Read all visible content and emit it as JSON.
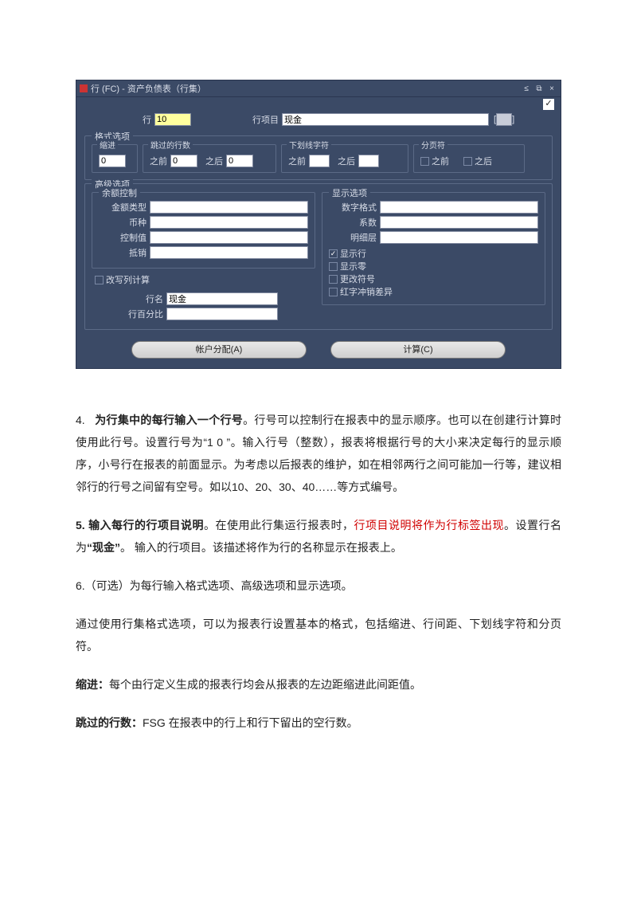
{
  "window": {
    "title": "行 (FC) - 资产负债表（行集）",
    "top_checked": "✓",
    "row_label": "行",
    "row_value": "10",
    "item_label": "行项目",
    "item_value": "现金",
    "bracket_left": "[",
    "bracket_right": "]"
  },
  "format": {
    "group": "格式选项",
    "indent_group": "缩进",
    "indent_value": "0",
    "skip_group": "跳过的行数",
    "before_label": "之前",
    "before_value": "0",
    "after_label": "之后",
    "after_value": "0",
    "underline_group": "下划线字符",
    "pagebreak_group": "分页符",
    "pb_before": "之前",
    "pb_after": "之后"
  },
  "adv": {
    "group": "高级选项",
    "balance_group": "余额控制",
    "amount_type": "金额类型",
    "currency": "币种",
    "control": "控制值",
    "offset": "抵销",
    "display_group": "显示选项",
    "num_format": "数字格式",
    "coeff": "系数",
    "detail": "明细层",
    "show_row": "显示行",
    "show_zero": "显示零",
    "override_symbol": "更改符号",
    "red_offset": "红字冲销差异",
    "rewrite_col": "改写列计算",
    "row_name_label": "行名",
    "row_name_value": "现金",
    "pct_label": "行百分比"
  },
  "buttons": {
    "alloc": "帐户分配(A)",
    "calc": "计算(C)"
  },
  "doc": {
    "p4a": "4.",
    "p4b": "为行集中的每行输入一个行号",
    "p4c": "。行号可以控制行在报表中的显示顺序。也可以在创建行计算时使用此行号。设置行号为“1 0 ”。输入行号（整数），报表将根据行号的大小来决定每行的显示顺序，小号行在报表的前面显示。为考虑以后报表的维护，如在相邻两行之间可能加一行等，建议相邻行的行号之间留有空号。如以10、20、30、40……等方式编号。",
    "p5a": "5. 输入每行的行项目说明",
    "p5b": "。在使用此行集运行报表时，",
    "p5c": "行项目说明将作为行标签出现",
    "p5d": "。设置行名为",
    "p5e": "“现金”",
    "p5f": "。 输入的行项目。该描述将作为行的名称显示在报表上。",
    "p6": "6.（可选）为每行输入格式选项、高级选项和显示选项。",
    "p6b": "通过使用行集格式选项，可以为报表行设置基本的格式，包括缩进、行间距、下划线字符和分页符。",
    "p7a": "缩进：",
    "p7b": "每个由行定义生成的报表行均会从报表的左边距缩进此间距值。",
    "p8a": "跳过的行数：",
    "p8b": "FSG 在报表中的行上和行下留出的空行数。"
  }
}
